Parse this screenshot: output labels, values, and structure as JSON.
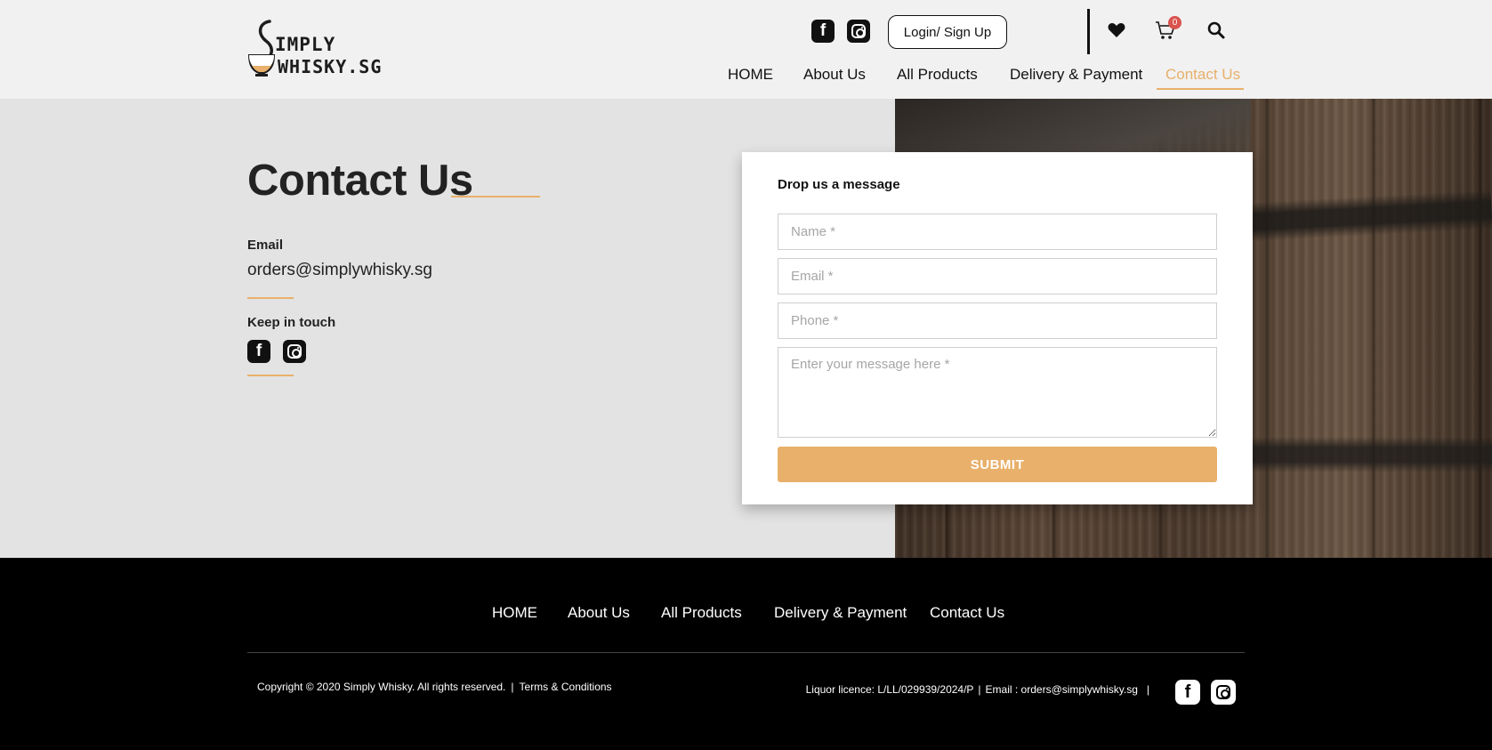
{
  "brand": {
    "line1": "IMPLY",
    "line2": "WHISKY.SG",
    "accent_color": "#e8b06a"
  },
  "header": {
    "social": [
      {
        "name": "facebook-icon",
        "glyph": "f"
      },
      {
        "name": "instagram-icon",
        "glyph": ""
      }
    ],
    "login_label": "Login/ Sign Up",
    "icons": [
      "heart-icon",
      "cart-icon",
      "search-icon"
    ],
    "cart_count": "0",
    "nav": [
      {
        "label": "HOME",
        "active": false
      },
      {
        "label": "About Us",
        "active": false
      },
      {
        "label": "All Products",
        "active": false
      },
      {
        "label": "Delivery & Payment",
        "active": false
      },
      {
        "label": "Contact Us",
        "active": true
      }
    ]
  },
  "contact": {
    "title": "Contact Us",
    "email_label": "Email",
    "email_value": "orders@simplywhisky.sg",
    "keep_label": "Keep in touch"
  },
  "form": {
    "heading": "Drop us a message",
    "name_placeholder": "Name *",
    "email_placeholder": "Email *",
    "phone_placeholder": "Phone *",
    "message_placeholder": "Enter your message here *",
    "submit_label": "SUBMIT"
  },
  "footer": {
    "nav": [
      "HOME",
      "About Us",
      "All Products",
      "Delivery & Payment",
      "Contact Us"
    ],
    "copyright": "Copyright © 2020 Simply Whisky. All rights reserved.",
    "separator": "|",
    "terms": "Terms & Conditions",
    "licence": "Liquor licence: L/LL/029939/2024/P",
    "email": "Email : orders@simplywhisky.sg"
  }
}
